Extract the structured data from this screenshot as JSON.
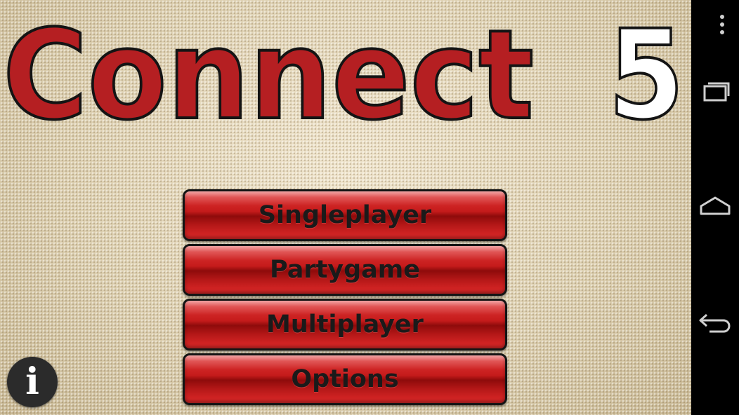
{
  "title": {
    "word": "Connect",
    "number": "5"
  },
  "menu": {
    "items": [
      {
        "label": "Singleplayer"
      },
      {
        "label": "Partygame"
      },
      {
        "label": "Multiplayer"
      },
      {
        "label": "Options"
      }
    ]
  },
  "info_button": {
    "label": "i"
  },
  "colors": {
    "title_red": "#b51f22",
    "button_red": "#c51b1b",
    "background": "#d8c9a6",
    "nav_bar": "#000000"
  },
  "nav_bar": {
    "icons": [
      "overflow-menu-icon",
      "recent-apps-icon",
      "home-icon",
      "back-icon"
    ]
  }
}
